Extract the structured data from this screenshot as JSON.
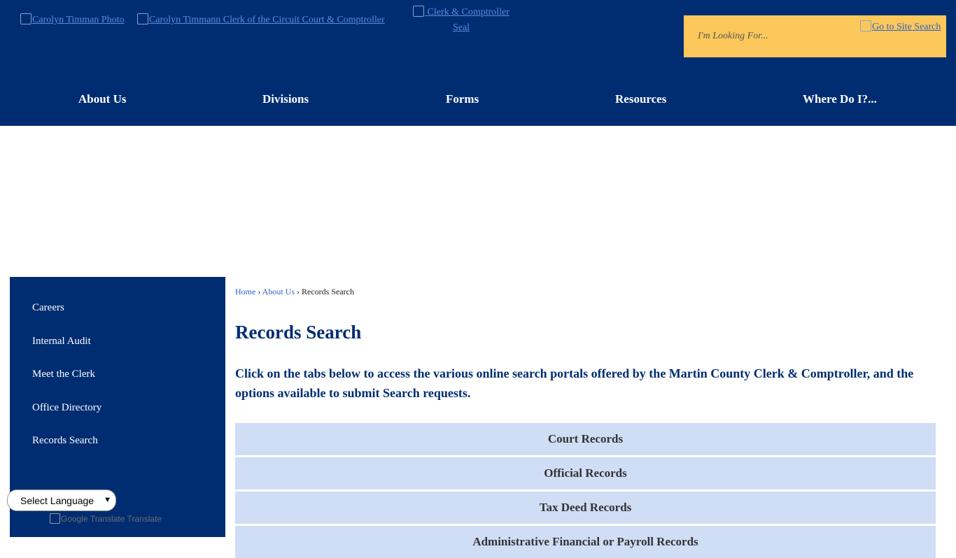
{
  "header": {
    "logo_photo_alt": "Carolyn Timman Photo",
    "logo_name_alt": "Carolyn Timmann Clerk of the Circuit Court & Comptroller",
    "logo_seal_alt": "Clerk & Comptroller Seal",
    "search_placeholder": "I'm Looking For...",
    "search_button_alt": "Go to Site Search",
    "background_color": "#002d72",
    "search_color": "#fdc85b"
  },
  "nav": {
    "items": [
      "About Us",
      "Divisions",
      "Forms",
      "Resources",
      "Where Do I?..."
    ]
  },
  "sidebar": {
    "items": [
      "Careers",
      "Internal Audit",
      "Meet the Clerk",
      "Office Directory",
      "Records Search"
    ]
  },
  "translate": {
    "select_label": "Select Language",
    "credit": "Google Translate Translate"
  },
  "breadcrumb": {
    "home": "Home",
    "parent": "About Us",
    "current": "Records Search",
    "separator": "›"
  },
  "main": {
    "title": "Records Search",
    "intro": "Click on the tabs below to access the various online search portals offered by the Martin County Clerk & Comptroller, and the options available to submit Search requests.",
    "tabs": [
      "Court Records",
      "Official Records",
      "Tax Deed Records",
      "Administrative Financial or Payroll Records"
    ],
    "tab_color": "#cfddf5"
  }
}
